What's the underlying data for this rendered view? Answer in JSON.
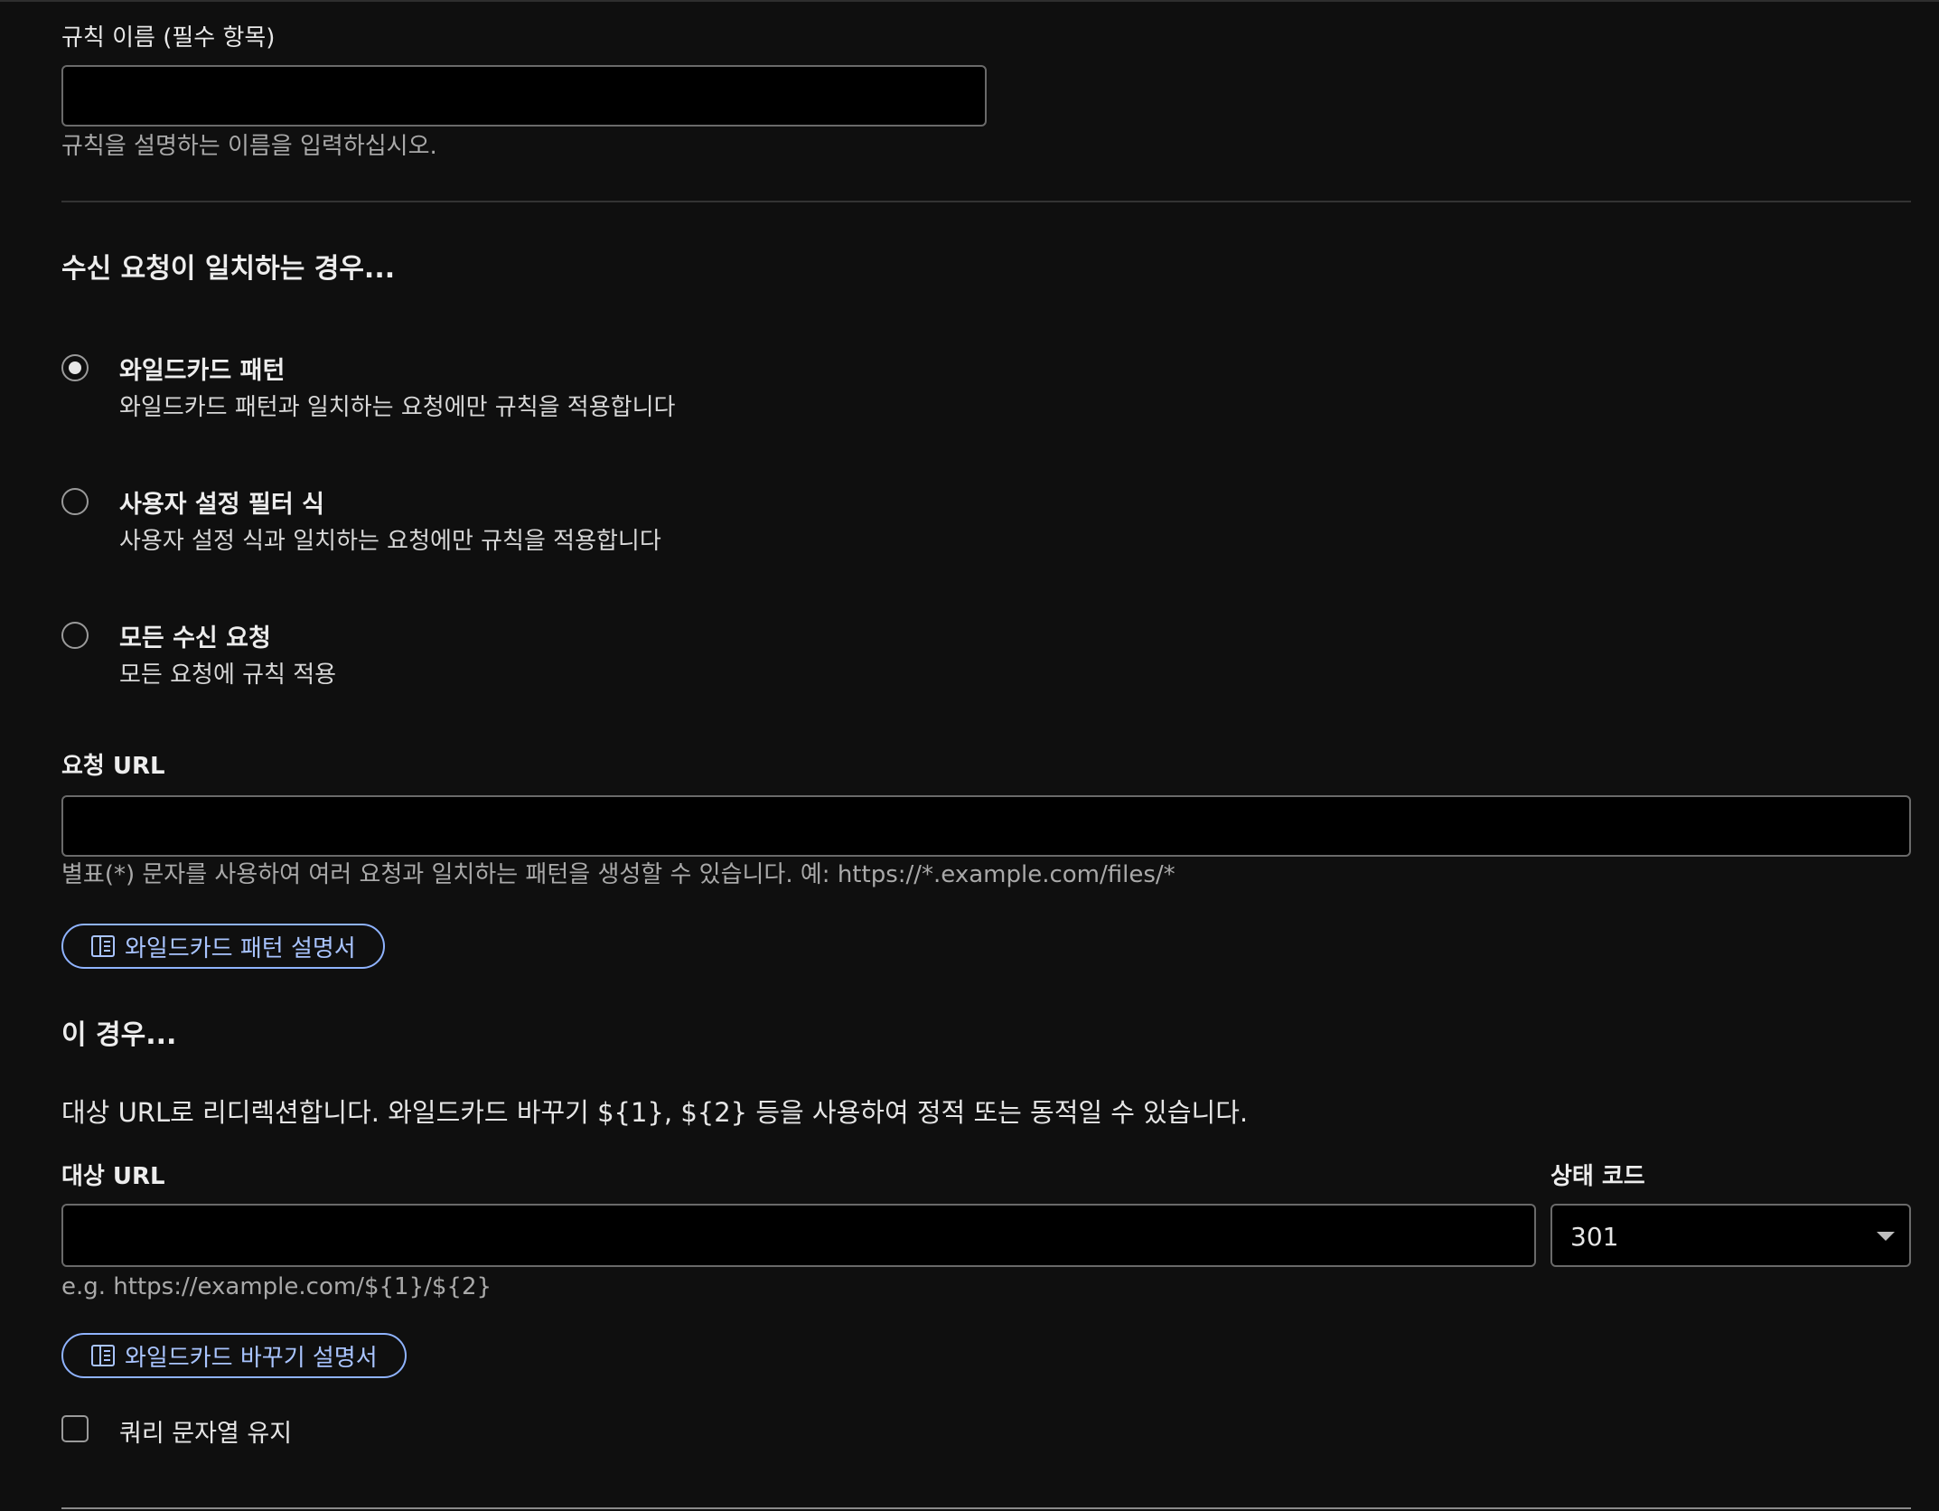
{
  "rule_name": {
    "label": "규칙 이름 (필수 항목)",
    "value": "",
    "helper": "규칙을 설명하는 이름을 입력하십시오."
  },
  "match_section": {
    "title": "수신 요청이 일치하는 경우...",
    "options": [
      {
        "title": "와일드카드 패턴",
        "description": "와일드카드 패턴과 일치하는 요청에만 규칙을 적용합니다",
        "selected": true
      },
      {
        "title": "사용자 설정 필터 식",
        "description": "사용자 설정 식과 일치하는 요청에만 규칙을 적용합니다",
        "selected": false
      },
      {
        "title": "모든 수신 요청",
        "description": "모든 요청에 규칙 적용",
        "selected": false
      }
    ]
  },
  "request_url": {
    "label": "요청 URL",
    "value": "",
    "helper": "별표(*) 문자를 사용하여 여러 요청과 일치하는 패턴을 생성할 수 있습니다. 예: https://*.example.com/files/*",
    "docs_button": "와일드카드 패턴 설명서"
  },
  "then_section": {
    "title": "이 경우...",
    "description": "대상 URL로 리디렉션합니다. 와일드카드 바꾸기 ${1}, ${2} 등을 사용하여 정적 또는 동적일 수 있습니다."
  },
  "target_url": {
    "label": "대상 URL",
    "value": "",
    "helper": "e.g. https://example.com/${1}/${2}",
    "docs_button": "와일드카드 바꾸기 설명서"
  },
  "status_code": {
    "label": "상태 코드",
    "value": "301"
  },
  "preserve_query": {
    "label": "쿼리 문자열 유지",
    "checked": false
  },
  "icons": {
    "docs": "book-icon",
    "select": "chevron-down-icon"
  },
  "colors": {
    "background": "#0f0f0f",
    "accent": "#8fb3ff",
    "input_bg": "#000000"
  }
}
